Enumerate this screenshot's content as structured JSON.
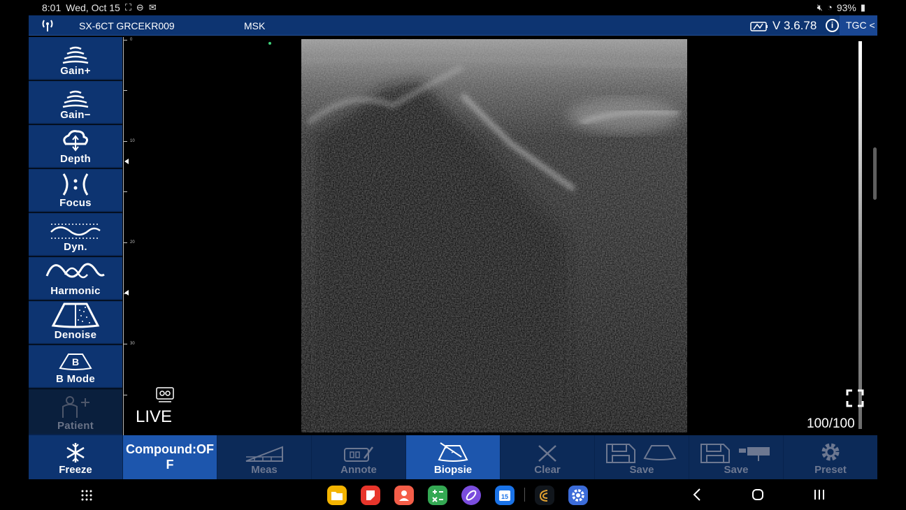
{
  "status_bar": {
    "time": "8:01",
    "date": "Wed, Oct 15",
    "battery": "93%"
  },
  "header": {
    "device": "SX-6CT GRCEKR009",
    "preset": "MSK",
    "version": "V 3.6.78",
    "info": "i",
    "tgc": "TGC <"
  },
  "sidebar": {
    "items": [
      {
        "label": "Gain+",
        "icon": "gain-up-icon"
      },
      {
        "label": "Gain−",
        "icon": "gain-down-icon"
      },
      {
        "label": "Depth",
        "icon": "depth-icon"
      },
      {
        "label": "Focus",
        "icon": "focus-icon"
      },
      {
        "label": "Dyn.",
        "icon": "dynamic-range-icon"
      },
      {
        "label": "Harmonic",
        "icon": "harmonic-icon"
      },
      {
        "label": "Denoise",
        "icon": "denoise-icon"
      },
      {
        "label": "B Mode",
        "icon": "b-mode-icon",
        "badge": "B"
      },
      {
        "label": "Patient",
        "icon": "patient-icon",
        "disabled": true
      }
    ]
  },
  "image": {
    "ruler_ticks": [
      "0",
      "10",
      "20",
      "30"
    ],
    "status": "LIVE",
    "frame_counter": "100/100"
  },
  "bottom_bar": {
    "freeze": "Freeze",
    "compound_line1": "Compound:OF",
    "compound_line2": "F",
    "meas": "Meas",
    "annote": "Annote",
    "biopsie": "Biopsie",
    "clear": "Clear",
    "save_image": "Save",
    "save_video": "Save",
    "preset": "Preset"
  },
  "colors": {
    "panel": "#0d3471",
    "active": "#1d56ad",
    "disabled_text": "#6d7891"
  }
}
